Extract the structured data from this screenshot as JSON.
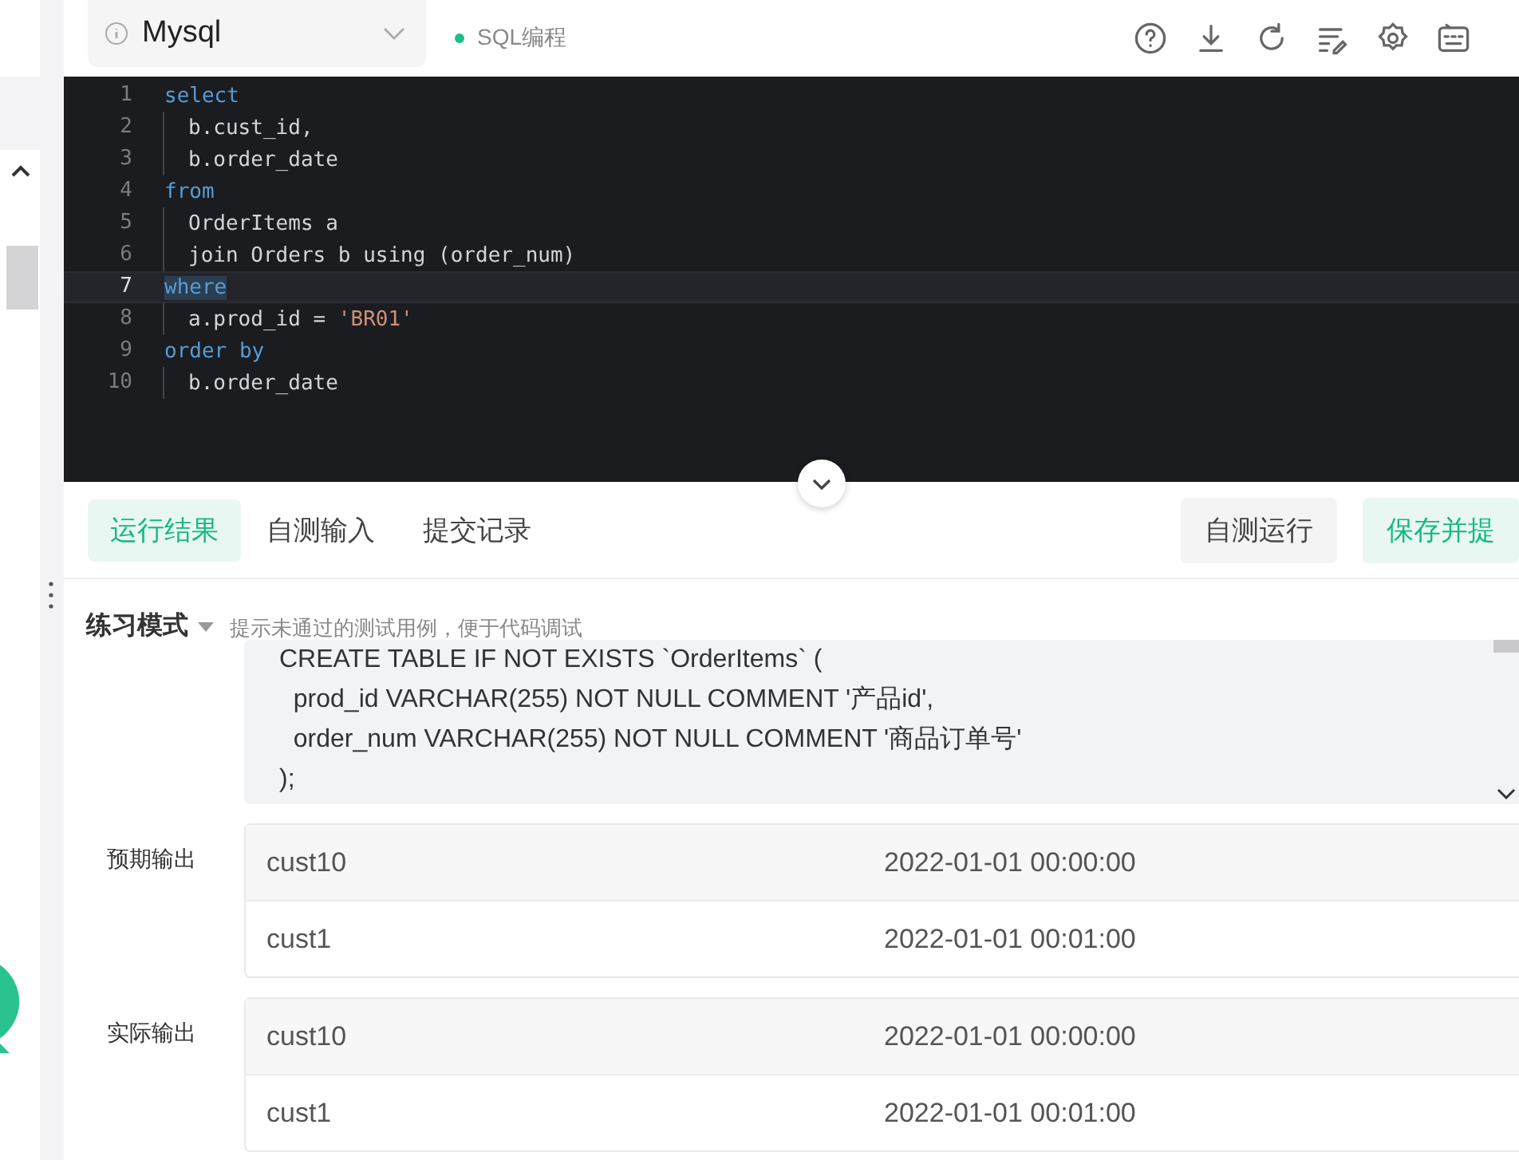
{
  "toolbar": {
    "language": "Mysql",
    "mode_label": "SQL编程"
  },
  "editor": {
    "lines": [
      {
        "number": "1",
        "active": false,
        "indented": false,
        "tokens": [
          {
            "kind": "keyword",
            "text": "select"
          }
        ]
      },
      {
        "number": "2",
        "active": false,
        "indented": true,
        "tokens": [
          {
            "kind": "plain",
            "text": "b.cust_id,"
          }
        ]
      },
      {
        "number": "3",
        "active": false,
        "indented": true,
        "tokens": [
          {
            "kind": "plain",
            "text": "b.order_date"
          }
        ]
      },
      {
        "number": "4",
        "active": false,
        "indented": false,
        "tokens": [
          {
            "kind": "keyword",
            "text": "from"
          }
        ]
      },
      {
        "number": "5",
        "active": false,
        "indented": true,
        "tokens": [
          {
            "kind": "plain",
            "text": "OrderItems a"
          }
        ]
      },
      {
        "number": "6",
        "active": false,
        "indented": true,
        "tokens": [
          {
            "kind": "plain",
            "text": "join Orders b using (order_num)"
          }
        ]
      },
      {
        "number": "7",
        "active": true,
        "indented": false,
        "tokens": [
          {
            "kind": "keyword",
            "text": "where"
          }
        ]
      },
      {
        "number": "8",
        "active": false,
        "indented": true,
        "tokens": [
          {
            "kind": "plain",
            "text": "a.prod_id = "
          },
          {
            "kind": "string",
            "text": "'BR01'"
          }
        ]
      },
      {
        "number": "9",
        "active": false,
        "indented": false,
        "tokens": [
          {
            "kind": "keyword",
            "text": "order by"
          }
        ]
      },
      {
        "number": "10",
        "active": false,
        "indented": true,
        "tokens": [
          {
            "kind": "plain",
            "text": "b.order_date"
          }
        ]
      }
    ]
  },
  "tabs": [
    {
      "label": "运行结果",
      "selected": true
    },
    {
      "label": "自测输入",
      "selected": false
    },
    {
      "label": "提交记录",
      "selected": false
    }
  ],
  "actions": [
    {
      "label": "自测运行",
      "kind": "secondary"
    },
    {
      "label": "保存并提",
      "kind": "primary"
    }
  ],
  "mode": {
    "label": "练习模式",
    "hint": "提示未通过的测试用例，便于代码调试"
  },
  "input_text": [
    "CREATE TABLE IF NOT EXISTS `OrderItems` (",
    "  prod_id VARCHAR(255) NOT NULL COMMENT '产品id',",
    "  order_num VARCHAR(255) NOT NULL COMMENT '商品订单号'",
    ");"
  ],
  "outputs": [
    {
      "label": "预期输出",
      "rows": [
        [
          "cust10",
          "2022-01-01 00:00:00"
        ],
        [
          "cust1",
          "2022-01-01 00:01:00"
        ]
      ]
    },
    {
      "label": "实际输出",
      "rows": [
        [
          "cust10",
          "2022-01-01 00:00:00"
        ],
        [
          "cust1",
          "2022-01-01 00:01:00"
        ]
      ]
    }
  ]
}
